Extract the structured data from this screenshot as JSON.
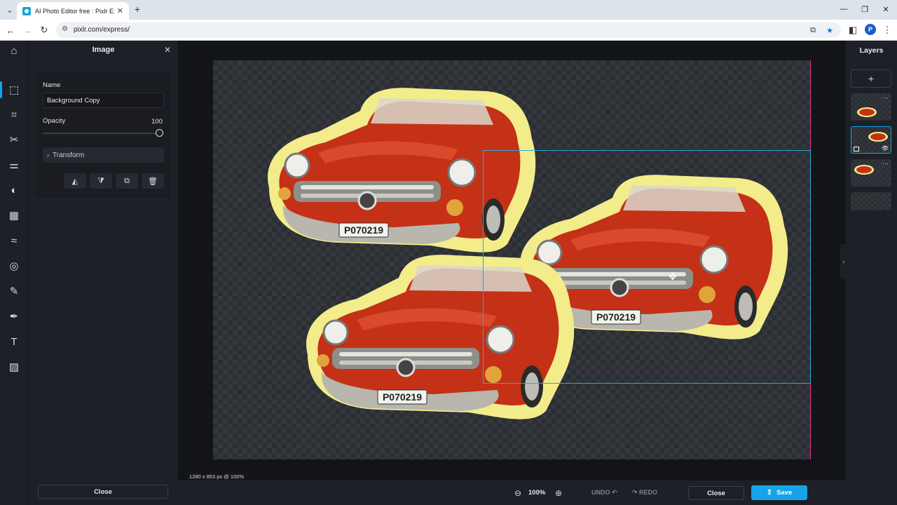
{
  "browser": {
    "tab_title": "AI Photo Editor free : Pixlr Express",
    "tab_close": "✕",
    "new_tab": "+",
    "url": "pixlr.com/express/",
    "profile_initial": "P",
    "window_controls": [
      "—",
      "❐",
      "✕"
    ]
  },
  "tools": [
    {
      "name": "home-icon",
      "glyph": "⌂"
    },
    {
      "name": "arrange-tool-icon",
      "glyph": "⬚"
    },
    {
      "name": "crop-tool-icon",
      "glyph": "⌗"
    },
    {
      "name": "cutout-tool-icon",
      "glyph": "✂"
    },
    {
      "name": "adjust-tool-icon",
      "glyph": "⚌"
    },
    {
      "name": "filter-tool-icon",
      "glyph": "◐"
    },
    {
      "name": "effect-tool-icon",
      "glyph": "▦"
    },
    {
      "name": "liquify-tool-icon",
      "glyph": "≈"
    },
    {
      "name": "swirl-tool-icon",
      "glyph": "◎"
    },
    {
      "name": "retouch-tool-icon",
      "glyph": "✎"
    },
    {
      "name": "draw-tool-icon",
      "glyph": "✒"
    },
    {
      "name": "text-tool-icon",
      "glyph": "T"
    },
    {
      "name": "pattern-tool-icon",
      "glyph": "▨"
    }
  ],
  "panel": {
    "title": "Image",
    "close_glyph": "✕",
    "name_label": "Name",
    "name_value": "Background Copy",
    "opacity_label": "Opacity",
    "opacity_value": "100",
    "opacity_level": 1.0,
    "transform_label": "Transform",
    "transform_chevron": "›",
    "actions": [
      {
        "name": "flip-horizontal-icon",
        "glyph": "◭"
      },
      {
        "name": "flip-vertical-icon",
        "glyph": "⧩"
      },
      {
        "name": "duplicate-icon",
        "glyph": "⧉"
      },
      {
        "name": "delete-icon",
        "glyph": "🗑"
      }
    ],
    "close_button": "Close"
  },
  "canvas": {
    "dimensions_text": "1280 x 853 px @ 100%",
    "guide_color": "#e0348f",
    "selection_color": "#2ba8d8",
    "sticker_outline_color": "#f5ef8a",
    "car_color": "#c8321c"
  },
  "layers": {
    "title": "Layers",
    "add_glyph": "+",
    "menu_glyph": "···",
    "eye_glyph": "👁"
  },
  "bottom": {
    "zoom_out_glyph": "⊖",
    "zoom_value": "100%",
    "zoom_in_glyph": "⊕",
    "undo_label": "UNDO ↶",
    "redo_label": "↷ REDO",
    "close_label": "Close",
    "save_label": "Save",
    "save_icon": "⇪"
  },
  "accent_color": "#16a4e8"
}
